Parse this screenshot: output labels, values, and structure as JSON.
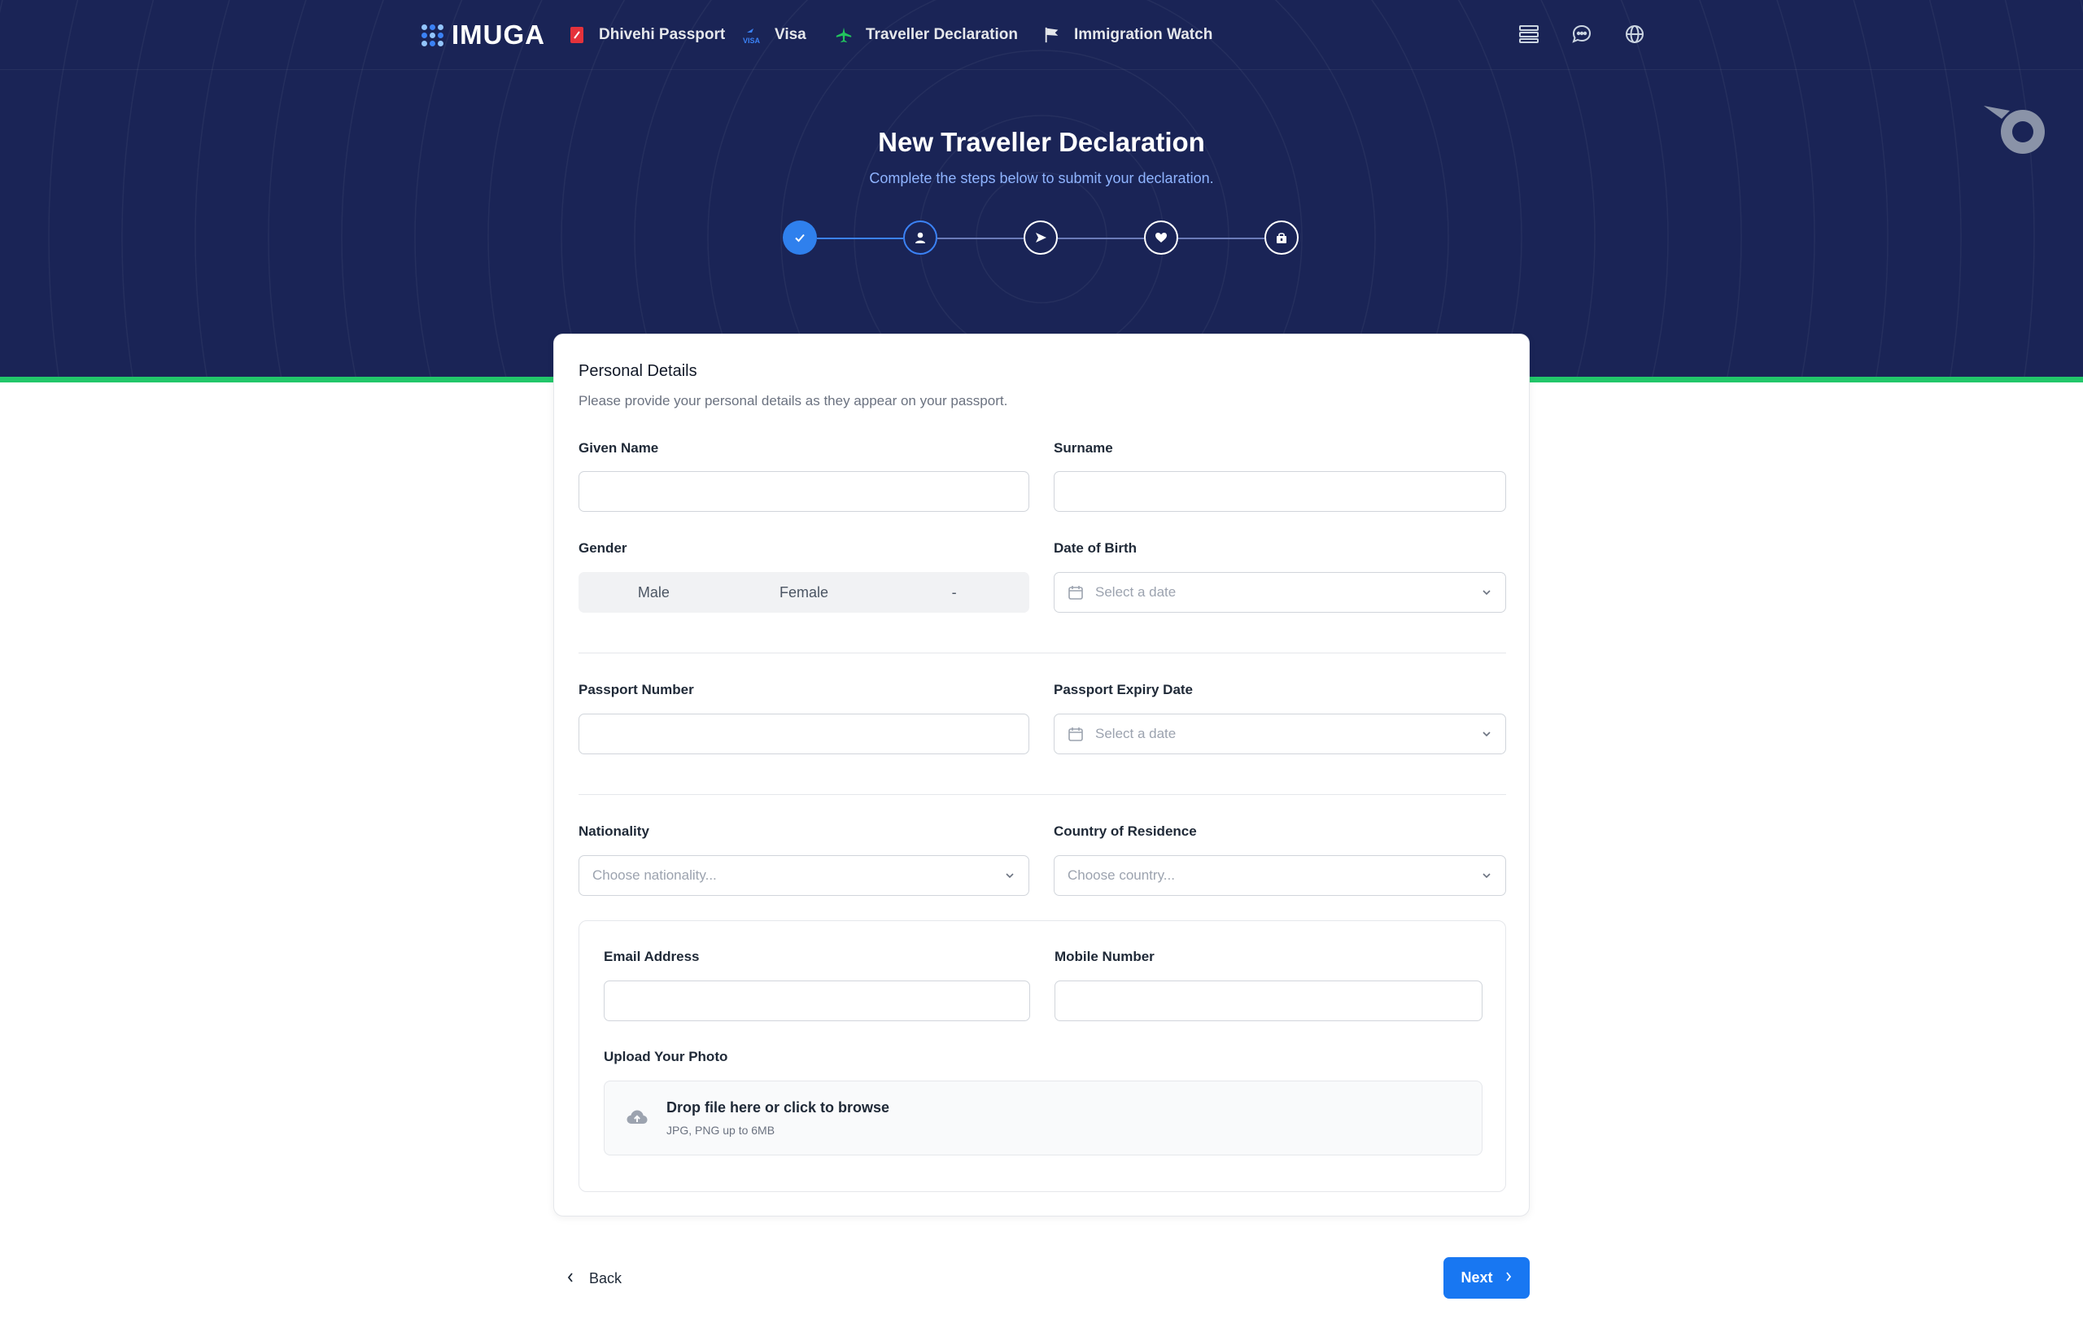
{
  "brand": {
    "name": "IMUGA"
  },
  "nav": {
    "items": [
      {
        "label": "Dhivehi Passport",
        "icon": "passport-icon"
      },
      {
        "label": "Visa",
        "icon": "visa-icon"
      },
      {
        "label": "Traveller Declaration",
        "icon": "airplane-icon"
      },
      {
        "label": "Immigration Watch",
        "icon": "flag-icon"
      }
    ],
    "right_icons": [
      "list-icon",
      "chat-icon",
      "globe-icon"
    ]
  },
  "hero": {
    "title": "New Traveller Declaration",
    "subtitle": "Complete the steps below to submit your declaration."
  },
  "stepper": {
    "steps": [
      {
        "state": "completed",
        "icon": "check-icon"
      },
      {
        "state": "active",
        "icon": "person-icon"
      },
      {
        "state": "upcoming",
        "icon": "send-icon"
      },
      {
        "state": "upcoming",
        "icon": "heart-icon"
      },
      {
        "state": "upcoming",
        "icon": "shop-icon"
      }
    ]
  },
  "form": {
    "title": "Personal Details",
    "subtitle": "Please provide your personal details as they appear on your passport.",
    "given_name": {
      "label": "Given Name",
      "value": ""
    },
    "surname": {
      "label": "Surname",
      "value": ""
    },
    "gender": {
      "label": "Gender",
      "options": [
        "Male",
        "Female",
        "-"
      ]
    },
    "dob": {
      "label": "Date of Birth",
      "placeholder": "Select a date"
    },
    "passport_number": {
      "label": "Passport Number",
      "value": ""
    },
    "passport_expiry": {
      "label": "Passport Expiry Date",
      "placeholder": "Select a date"
    },
    "nationality": {
      "label": "Nationality",
      "placeholder": "Choose nationality..."
    },
    "residence": {
      "label": "Country of Residence",
      "placeholder": "Choose country..."
    },
    "email": {
      "label": "Email Address",
      "value": ""
    },
    "mobile": {
      "label": "Mobile Number",
      "value": ""
    },
    "photo": {
      "label": "Upload Your Photo",
      "drop_text": "Drop file here or click to browse",
      "hint": "JPG, PNG up to 6MB"
    }
  },
  "footer": {
    "back_label": "Back",
    "next_label": "Next"
  },
  "colors": {
    "hero_bg": "#1a2456",
    "accent": "#1877f2",
    "stripe": "#22c76a"
  }
}
